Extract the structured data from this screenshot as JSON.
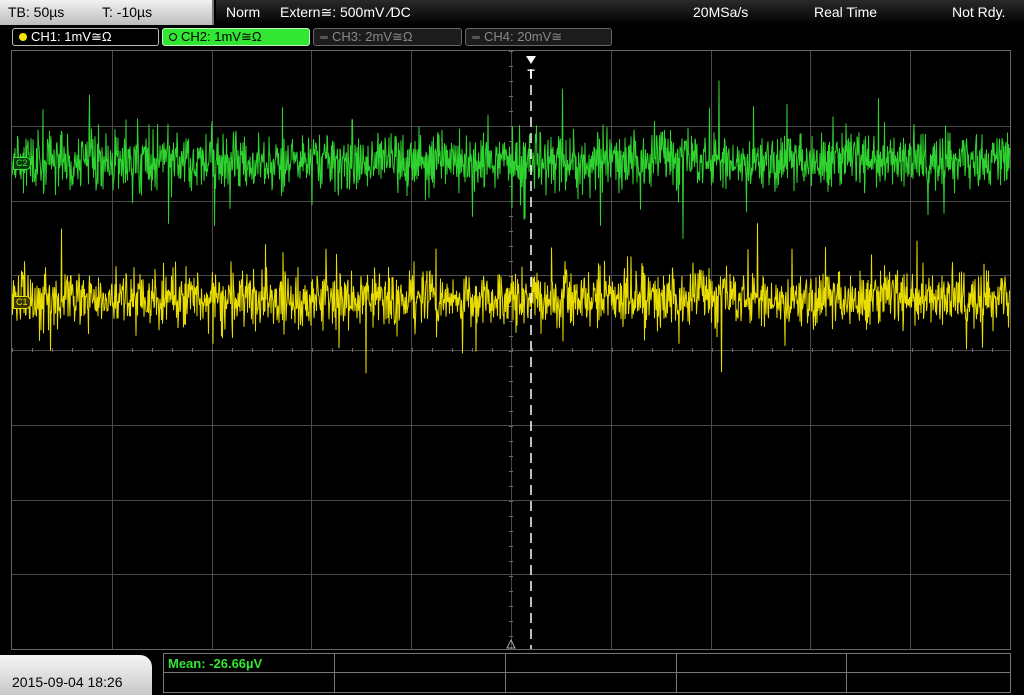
{
  "topbar": {
    "timebase": "TB: 50µs",
    "trigger_time": "T: -10µs",
    "trigger_mode": "Norm",
    "trigger_source": "Extern≅: 500mV ∕DC",
    "sample_rate": "20MSa/s",
    "acq_mode": "Real Time",
    "acq_status": "Not Rdy."
  },
  "channels": [
    {
      "label": "CH1: 1mV≅Ω",
      "color": "#f5e800",
      "active": true
    },
    {
      "label": "CH2: 1mV≅Ω",
      "color": "#33e633",
      "active": true,
      "selected": true
    },
    {
      "label": "CH3: 2mV≅Ω",
      "color": "#888888",
      "active": false
    },
    {
      "label": "CH4: 20mV≅",
      "color": "#888888",
      "active": false
    }
  ],
  "markers": {
    "ch1": "C1",
    "ch2": "C2",
    "trigger": "T"
  },
  "measurements": {
    "mean_label": "Mean: -26.66µV"
  },
  "footer": {
    "datetime": "2015-09-04 18:26"
  },
  "colors": {
    "ch1": "#e8dc00",
    "ch2": "#2fd32f",
    "grid": "#4a4a4a",
    "trigger": "#ffffff"
  }
}
